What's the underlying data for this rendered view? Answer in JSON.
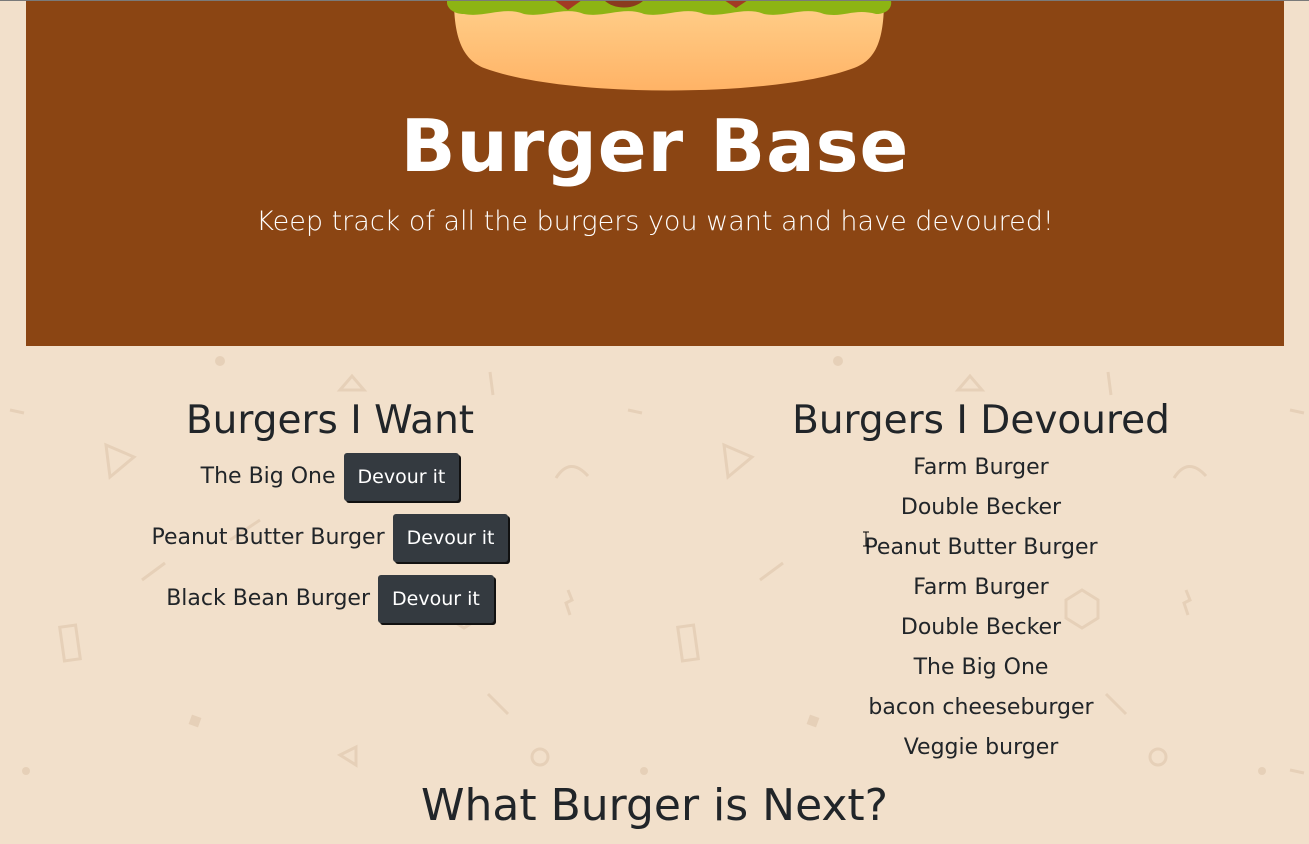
{
  "colors": {
    "page_background": "#f2e0cb",
    "hero_background": "#8b4513",
    "hero_text": "#ffffff",
    "button_background": "#343a40",
    "button_text": "#ffffff",
    "body_text": "#212529"
  },
  "hero": {
    "image": "burger-illustration-icon",
    "title": "Burger Base",
    "subtitle": "Keep track of all the burgers you want and have devoured!"
  },
  "want": {
    "heading": "Burgers I Want",
    "button_label": "Devour it",
    "items": [
      {
        "name": "The Big One"
      },
      {
        "name": "Peanut Butter Burger"
      },
      {
        "name": "Black Bean Burger"
      }
    ]
  },
  "devoured": {
    "heading": "Burgers I Devoured",
    "items": [
      "Farm Burger",
      "Double Becker",
      "Peanut Butter Burger",
      "Farm Burger",
      "Double Becker",
      "The Big One",
      "bacon cheeseburger",
      "Veggie burger"
    ]
  },
  "next": {
    "heading": "What Burger is Next?"
  }
}
